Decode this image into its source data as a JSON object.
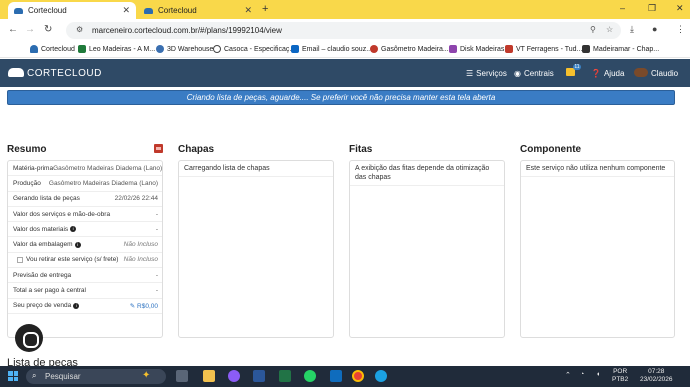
{
  "browser": {
    "tabs": [
      {
        "title": "Cortecloud"
      },
      {
        "title": "Cortecloud"
      }
    ],
    "new_tab": "+",
    "window_controls": {
      "minimize": "–",
      "restore": "❐",
      "close": "✕"
    },
    "url": "marceneiro.cortecloud.com.br/#/plans/19992104/view"
  },
  "bookmarks": [
    {
      "label": "Cortecloud",
      "color": "#2b6cb0"
    },
    {
      "label": "Leo Madeiras - A M...",
      "color": "#1f7a3a"
    },
    {
      "label": "3D Warehouse",
      "color": "#3a6fb0"
    },
    {
      "label": "Casoca - Especificaç...",
      "color": "#444444"
    },
    {
      "label": "Email – claudio souz...",
      "color": "#0b66c3"
    },
    {
      "label": "Gasômetro Madeira...",
      "color": "#c0392b"
    },
    {
      "label": "Disk Madeiras",
      "color": "#8e44ad"
    },
    {
      "label": "VT Ferragens - Tud...",
      "color": "#c0392b"
    },
    {
      "label": "Madeiramar - Chap...",
      "color": "#333333"
    }
  ],
  "app": {
    "logo": "CORTECLOUD",
    "nav": {
      "servicos": "Serviços",
      "centrais": "Centrais",
      "notif_count": "11",
      "ajuda": "Ajuda",
      "user": "Claudio"
    },
    "banner": "Criando lista de peças, aguarde.... Se preferir você não precisa manter esta tela aberta"
  },
  "resumo": {
    "title": "Resumo",
    "rows": [
      {
        "label": "Matéria-prima",
        "value": "Gasômetro Madeiras Diadema (Lano)"
      },
      {
        "label": "Produção",
        "value": "Gasômetro Madeiras Diadema (Lano)"
      },
      {
        "label": "Gerando lista de peças",
        "value": "22/02/26 22:44"
      },
      {
        "label": "Valor dos serviços e mão-de-obra",
        "value": "-"
      },
      {
        "label": "Valor dos materiais",
        "value": "-"
      },
      {
        "label": "Valor da embalagem",
        "value": "Não Incluso"
      },
      {
        "label": "Vou retirar este serviço (s/ frete)",
        "value": "Não Incluso"
      },
      {
        "label": "Previsão de entrega",
        "value": "-"
      },
      {
        "label": "Total a ser pago à central",
        "value": "-"
      },
      {
        "label": "Seu preço de venda",
        "value": "R$0,00"
      }
    ]
  },
  "chapas": {
    "title": "Chapas",
    "text": "Carregando lista de chapas"
  },
  "fitas": {
    "title": "Fitas",
    "text": "A exibição das fitas depende da otimização das chapas"
  },
  "componente": {
    "title": "Componente",
    "text": "Este serviço não utiliza nenhum componente"
  },
  "lista_pecas": "Lista de peças",
  "taskbar": {
    "search_placeholder": "Pesquisar",
    "lang_line1": "POR",
    "lang_line2": "PTB2",
    "time": "07:28",
    "date": "23/02/2026"
  }
}
